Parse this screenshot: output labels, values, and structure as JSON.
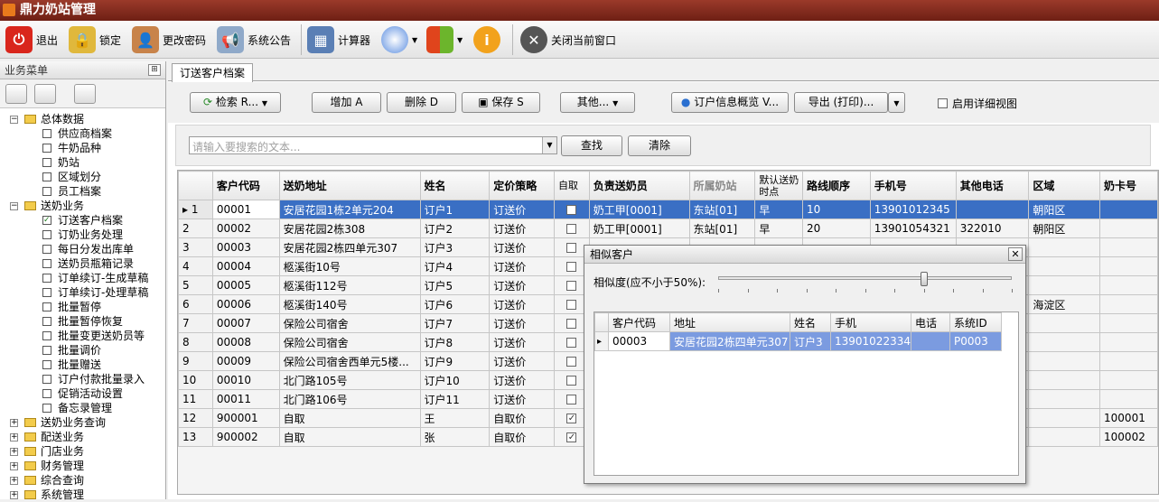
{
  "app": {
    "title": "鼎力奶站管理"
  },
  "toolbar": [
    {
      "label": "退出",
      "icon": "power-icon"
    },
    {
      "label": "锁定",
      "icon": "lock-icon"
    },
    {
      "label": "更改密码",
      "icon": "user-key-icon"
    },
    {
      "label": "系统公告",
      "icon": "megaphone-icon"
    },
    {
      "label": "计算器",
      "icon": "calculator-icon"
    },
    {
      "label": "",
      "icon": "palette-icon"
    },
    {
      "label": "",
      "icon": "windows-icon"
    },
    {
      "label": "",
      "icon": "info-icon"
    },
    {
      "label": "关闭当前窗口",
      "icon": "close-icon"
    }
  ],
  "sidebar": {
    "title": "业务菜单",
    "tree": [
      {
        "label": "总体数据",
        "type": "folder",
        "expanded": true,
        "level": 0
      },
      {
        "label": "供应商档案",
        "type": "leaf",
        "level": 1
      },
      {
        "label": "牛奶品种",
        "type": "leaf",
        "level": 1
      },
      {
        "label": "奶站",
        "type": "leaf",
        "level": 1
      },
      {
        "label": "区域划分",
        "type": "leaf",
        "level": 1
      },
      {
        "label": "员工档案",
        "type": "leaf",
        "level": 1
      },
      {
        "label": "送奶业务",
        "type": "folder",
        "expanded": true,
        "level": 0
      },
      {
        "label": "订送客户档案",
        "type": "leaf",
        "checked": true,
        "level": 1
      },
      {
        "label": "订奶业务处理",
        "type": "leaf",
        "level": 1
      },
      {
        "label": "每日分发出库单",
        "type": "leaf",
        "level": 1
      },
      {
        "label": "送奶员瓶箱记录",
        "type": "leaf",
        "level": 1
      },
      {
        "label": "订单续订-生成草稿",
        "type": "leaf",
        "level": 1
      },
      {
        "label": "订单续订-处理草稿",
        "type": "leaf",
        "level": 1
      },
      {
        "label": "批量暂停",
        "type": "leaf",
        "level": 1
      },
      {
        "label": "批量暂停恢复",
        "type": "leaf",
        "level": 1
      },
      {
        "label": "批量变更送奶员等",
        "type": "leaf",
        "level": 1
      },
      {
        "label": "批量调价",
        "type": "leaf",
        "level": 1
      },
      {
        "label": "批量赠送",
        "type": "leaf",
        "level": 1
      },
      {
        "label": "订户付款批量录入",
        "type": "leaf",
        "level": 1
      },
      {
        "label": "促销活动设置",
        "type": "leaf",
        "level": 1
      },
      {
        "label": "备忘录管理",
        "type": "leaf",
        "level": 1
      },
      {
        "label": "送奶业务查询",
        "type": "folder",
        "expanded": false,
        "level": 0
      },
      {
        "label": "配送业务",
        "type": "folder",
        "expanded": false,
        "level": 0
      },
      {
        "label": "门店业务",
        "type": "folder",
        "expanded": false,
        "level": 0
      },
      {
        "label": "财务管理",
        "type": "folder",
        "expanded": false,
        "level": 0
      },
      {
        "label": "综合查询",
        "type": "folder",
        "expanded": false,
        "level": 0
      },
      {
        "label": "系统管理",
        "type": "folder",
        "expanded": false,
        "level": 0
      }
    ]
  },
  "main": {
    "tab": "订送客户档案",
    "actions": {
      "retrieve": "检索 R...",
      "add": "增加 A",
      "delete": "删除 D",
      "save": "保存 S",
      "other": "其他...",
      "overview": "订户信息概览 V...",
      "export": "导出 (打印)...",
      "detail_view": "启用详细视图"
    },
    "search": {
      "placeholder": "请输入要搜索的文本...",
      "query": "查找",
      "clear": "清除"
    },
    "table": {
      "columns": [
        "",
        "客户代码",
        "送奶地址",
        "姓名",
        "定价策略",
        "自取",
        "负责送奶员",
        "所属奶站",
        "默认送奶时点",
        "路线顺序",
        "手机号",
        "其他电话",
        "区域",
        "奶卡号"
      ],
      "rows": [
        {
          "num": "1",
          "code": "00001",
          "addr": "安居花园1栋2单元204",
          "name": "订户1",
          "price": "订送价",
          "self": false,
          "courier": "奶工甲[0001]",
          "station": "东站[01]",
          "time": "早",
          "route": "10",
          "mobile": "13901012345",
          "phone": "",
          "area": "朝阳区",
          "card": ""
        },
        {
          "num": "2",
          "code": "00002",
          "addr": "安居花园2栋308",
          "name": "订户2",
          "price": "订送价",
          "self": false,
          "courier": "奶工甲[0001]",
          "station": "东站[01]",
          "time": "早",
          "route": "20",
          "mobile": "13901054321",
          "phone": "322010",
          "area": "朝阳区",
          "card": ""
        },
        {
          "num": "3",
          "code": "00003",
          "addr": "安居花园2栋四单元307",
          "name": "订户3",
          "price": "订送价",
          "self": false,
          "courier": "",
          "station": "",
          "time": "",
          "route": "",
          "mobile": "",
          "phone": "",
          "area": "",
          "card": ""
        },
        {
          "num": "4",
          "code": "00004",
          "addr": "柩溪街10号",
          "name": "订户4",
          "price": "订送价",
          "self": false,
          "courier": "",
          "station": "",
          "time": "",
          "route": "",
          "mobile": "",
          "phone": "",
          "area": "",
          "card": ""
        },
        {
          "num": "5",
          "code": "00005",
          "addr": "柩溪街112号",
          "name": "订户5",
          "price": "订送价",
          "self": false,
          "courier": "",
          "station": "",
          "time": "",
          "route": "",
          "mobile": "",
          "phone": "",
          "area": "",
          "card": ""
        },
        {
          "num": "6",
          "code": "00006",
          "addr": "柩溪街140号",
          "name": "订户6",
          "price": "订送价",
          "self": false,
          "courier": "",
          "station": "",
          "time": "",
          "route": "",
          "mobile": "",
          "phone": "",
          "area": "海淀区",
          "card": ""
        },
        {
          "num": "7",
          "code": "00007",
          "addr": "保险公司宿舍",
          "name": "订户7",
          "price": "订送价",
          "self": false,
          "courier": "",
          "station": "",
          "time": "",
          "route": "",
          "mobile": "",
          "phone": "",
          "area": "",
          "card": ""
        },
        {
          "num": "8",
          "code": "00008",
          "addr": "保险公司宿舍",
          "name": "订户8",
          "price": "订送价",
          "self": false,
          "courier": "",
          "station": "",
          "time": "",
          "route": "",
          "mobile": "",
          "phone": "",
          "area": "",
          "card": ""
        },
        {
          "num": "9",
          "code": "00009",
          "addr": "保险公司宿舍西单元5楼...",
          "name": "订户9",
          "price": "订送价",
          "self": false,
          "courier": "",
          "station": "",
          "time": "",
          "route": "",
          "mobile": "",
          "phone": "",
          "area": "",
          "card": ""
        },
        {
          "num": "10",
          "code": "00010",
          "addr": "北门路105号",
          "name": "订户10",
          "price": "订送价",
          "self": false,
          "courier": "",
          "station": "",
          "time": "",
          "route": "",
          "mobile": "",
          "phone": "",
          "area": "",
          "card": ""
        },
        {
          "num": "11",
          "code": "00011",
          "addr": "北门路106号",
          "name": "订户11",
          "price": "订送价",
          "self": false,
          "courier": "",
          "station": "",
          "time": "",
          "route": "",
          "mobile": "",
          "phone": "",
          "area": "",
          "card": ""
        },
        {
          "num": "12",
          "code": "900001",
          "addr": "自取",
          "name": "王",
          "price": "自取价",
          "self": true,
          "courier": "",
          "station": "",
          "time": "",
          "route": "",
          "mobile": "",
          "phone": "",
          "area": "",
          "card": "100001"
        },
        {
          "num": "13",
          "code": "900002",
          "addr": "自取",
          "name": "张",
          "price": "自取价",
          "self": true,
          "courier": "",
          "station": "",
          "time": "",
          "route": "",
          "mobile": "",
          "phone": "",
          "area": "",
          "card": "100002"
        }
      ]
    }
  },
  "dialog": {
    "title": "相似客户",
    "similarity_label": "相似度(应不小于50%):",
    "similarity_value": 0.7,
    "columns": [
      "",
      "客户代码",
      "地址",
      "姓名",
      "手机",
      "电话",
      "系统ID"
    ],
    "rows": [
      {
        "code": "00003",
        "addr": "安居花园2栋四单元307",
        "name": "订户3",
        "mobile": "13901022334",
        "phone": "",
        "sysid": "P0003"
      }
    ]
  },
  "colors": {
    "selection": "#3a6fc4",
    "titlebar": "#7a2a1c"
  }
}
